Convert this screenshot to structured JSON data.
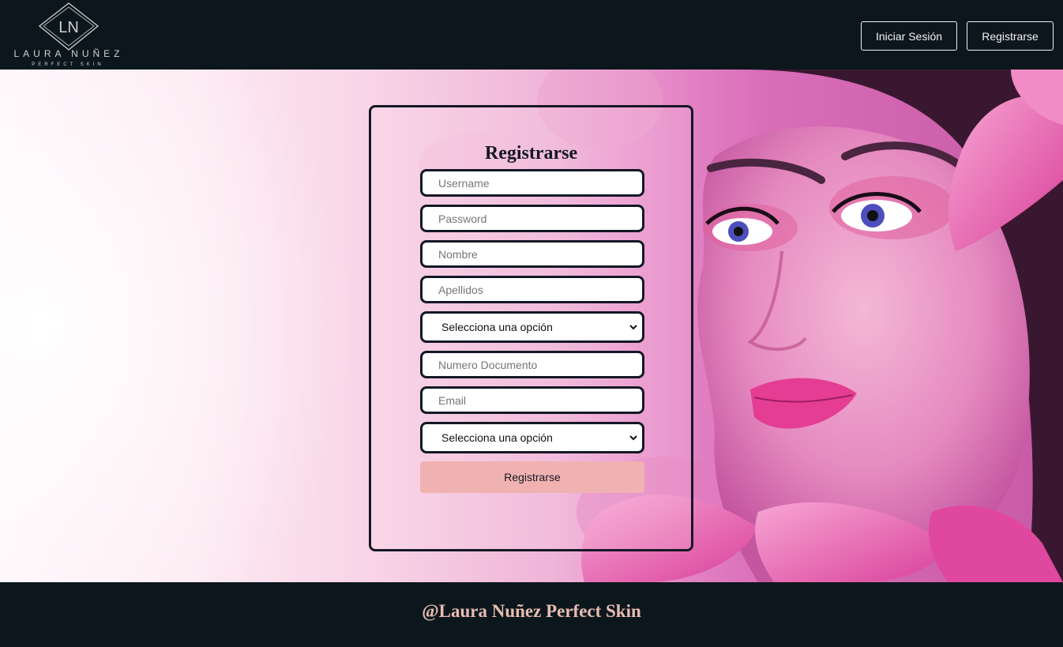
{
  "brand": {
    "monogram": "LN",
    "name": "LAURA NUÑEZ",
    "tagline": "PERFECT SKIN"
  },
  "header": {
    "login_label": "Iniciar Sesión",
    "register_label": "Registrarse"
  },
  "form": {
    "title": "Registrarse",
    "username_placeholder": "Username",
    "password_placeholder": "Password",
    "nombre_placeholder": "Nombre",
    "apellidos_placeholder": "Apellidos",
    "document_type_value": "Selecciona una opción",
    "document_number_placeholder": "Numero Documento",
    "email_placeholder": "Email",
    "second_select_value": "Selecciona una opción",
    "submit_label": "Registrarse"
  },
  "footer": {
    "text": "@Laura Nuñez Perfect Skin"
  },
  "colors": {
    "dark": "#0c171d",
    "accent_button": "#f0b2b0",
    "footer_text": "#e9bcb2",
    "field_border": "#141826"
  }
}
